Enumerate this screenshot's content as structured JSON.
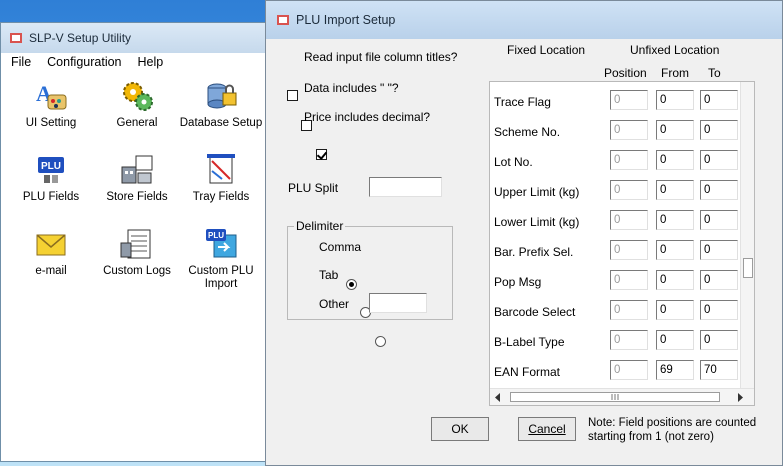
{
  "background_window": {
    "title": "SLP-V Setup Utility",
    "menu": [
      "File",
      "Configuration",
      "Help"
    ],
    "tiles": [
      {
        "label": "UI Setting",
        "icon": "ui-setting-icon"
      },
      {
        "label": "General",
        "icon": "gears-icon"
      },
      {
        "label": "Database Setup",
        "icon": "database-lock-icon"
      },
      {
        "label": "PLU Fields",
        "icon": "plu-icon"
      },
      {
        "label": "Store Fields",
        "icon": "store-fields-icon"
      },
      {
        "label": "Tray Fields",
        "icon": "tray-fields-icon"
      },
      {
        "label": "e-mail",
        "icon": "envelope-icon"
      },
      {
        "label": "Custom Logs",
        "icon": "custom-logs-icon"
      },
      {
        "label": "Custom PLU Import",
        "icon": "plu-import-icon"
      }
    ]
  },
  "dialog": {
    "title": "PLU Import Setup",
    "options": {
      "read_titles": {
        "label": "Read input file column titles?",
        "checked": false
      },
      "data_quotes": {
        "label": "Data includes \" \"?",
        "checked": false
      },
      "price_decimal": {
        "label": "Price includes decimal?",
        "checked": true
      }
    },
    "plu_split_label": "PLU Split",
    "plu_split_value": "",
    "delimiter": {
      "title": "Delimiter",
      "comma": "Comma",
      "tab": "Tab",
      "other": "Other",
      "other_value": "",
      "selected": "Comma"
    },
    "location": {
      "fixed": "Fixed Location",
      "unfixed": "Unfixed Location",
      "selected": "Unfixed Location"
    },
    "columns": {
      "position": "Position",
      "from": "From",
      "to": "To"
    },
    "rows": [
      {
        "name": "Trace Flag",
        "position": "0",
        "from": "0",
        "to": "0"
      },
      {
        "name": "Scheme No.",
        "position": "0",
        "from": "0",
        "to": "0"
      },
      {
        "name": "Lot No.",
        "position": "0",
        "from": "0",
        "to": "0"
      },
      {
        "name": "Upper Limit (kg)",
        "position": "0",
        "from": "0",
        "to": "0"
      },
      {
        "name": "Lower Limit (kg)",
        "position": "0",
        "from": "0",
        "to": "0"
      },
      {
        "name": "Bar. Prefix Sel.",
        "position": "0",
        "from": "0",
        "to": "0"
      },
      {
        "name": "Pop Msg",
        "position": "0",
        "from": "0",
        "to": "0"
      },
      {
        "name": "Barcode Select",
        "position": "0",
        "from": "0",
        "to": "0"
      },
      {
        "name": "B-Label Type",
        "position": "0",
        "from": "0",
        "to": "0"
      },
      {
        "name": "EAN Format",
        "position": "0",
        "from": "69",
        "to": "70"
      }
    ],
    "ok_label": "OK",
    "cancel_label": "Cancel",
    "note_line1": "Note: Field positions are counted",
    "note_line2": "starting from 1 (not zero)"
  },
  "colors": {
    "desktop_top": "#2f7fd6",
    "title_bar": "#c6d9ec",
    "dialog_bg": "#f0f0f0"
  }
}
